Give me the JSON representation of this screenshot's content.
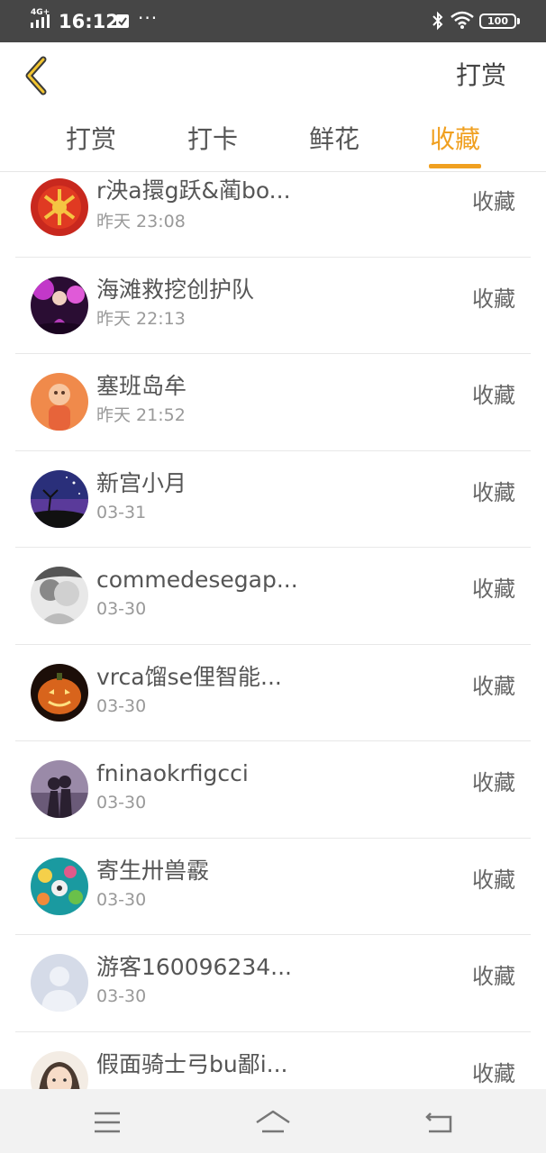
{
  "status_bar": {
    "network": "4G+",
    "time": "16:12",
    "more": "···",
    "battery": "100"
  },
  "header": {
    "title": "打赏"
  },
  "tabs": [
    {
      "label": "打赏",
      "active": false
    },
    {
      "label": "打卡",
      "active": false
    },
    {
      "label": "鲜花",
      "active": false
    },
    {
      "label": "收藏",
      "active": true
    }
  ],
  "accent_color": "#f0a020",
  "list": [
    {
      "name": "r泱a擐g跃&蔺bo...",
      "time": "昨天 23:08",
      "action": "收藏",
      "avatar": "red-fu-avatar"
    },
    {
      "name": "海滩救挖创护队",
      "time": "昨天 22:13",
      "action": "收藏",
      "avatar": "concert-avatar"
    },
    {
      "name": "塞班岛牟",
      "time": "昨天 21:52",
      "action": "收藏",
      "avatar": "boy-avatar"
    },
    {
      "name": "新宫小月",
      "time": "03-31",
      "action": "收藏",
      "avatar": "night-sky-avatar"
    },
    {
      "name": "commedesegap...",
      "time": "03-30",
      "action": "收藏",
      "avatar": "sketch-avatar"
    },
    {
      "name": "vrca馏se俚智能...",
      "time": "03-30",
      "action": "收藏",
      "avatar": "pumpkin-avatar"
    },
    {
      "name": "fninaokrfigcci",
      "time": "03-30",
      "action": "收藏",
      "avatar": "couple-avatar"
    },
    {
      "name": "寄生卅兽霰",
      "time": "03-30",
      "action": "收藏",
      "avatar": "flowers-avatar"
    },
    {
      "name": "游客160096234...",
      "time": "03-30",
      "action": "收藏",
      "avatar": "default-user-avatar"
    },
    {
      "name": "假面骑士弓bu鄙i...",
      "time": "",
      "action": "收藏",
      "avatar": "girl-avatar"
    }
  ]
}
